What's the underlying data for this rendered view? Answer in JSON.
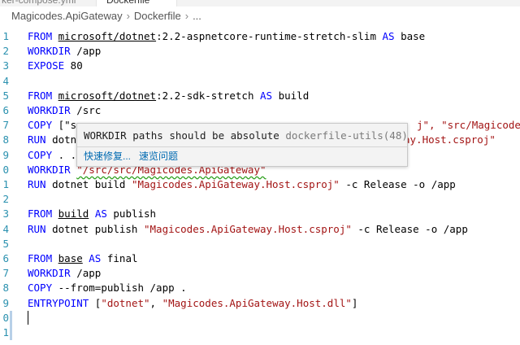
{
  "tabs": [
    {
      "label": "ker-compose.yml"
    },
    {
      "label": "Dockerfile"
    }
  ],
  "breadcrumbs": [
    "Magicodes.ApiGateway",
    "Dockerfile",
    "..."
  ],
  "editor": {
    "line_numbers": [
      "1",
      "2",
      "3",
      "4",
      "5",
      "6",
      "7",
      "8",
      "9",
      "0",
      "1",
      "2",
      "3",
      "4",
      "5",
      "6",
      "7",
      "8",
      "9",
      "0",
      "1"
    ],
    "lines": [
      {
        "kw": "FROM",
        "p1": " ",
        "ul": "microsoft/dotnet",
        "p2": ":2.2-aspnetcore-runtime-stretch-slim ",
        "kw2": "AS",
        "p3": " base"
      },
      {
        "kw": "WORKDIR",
        "p1": " /app"
      },
      {
        "kw": "EXPOSE",
        "p1": " 80"
      },
      {},
      {
        "kw": "FROM",
        "p1": " ",
        "ul": "microsoft/dotnet",
        "p2": ":2.2-sdk-stretch ",
        "kw2": "AS",
        "p3": " build"
      },
      {
        "kw": "WORKDIR",
        "p1": " /src"
      },
      {
        "kw": "COPY",
        "p1": " [\"s",
        "tail_str": "j\", \"src/Magicodes.Ap"
      },
      {
        "kw": "RUN",
        "p1": " dotn",
        "tail_str": "ay.Host.csproj\""
      },
      {
        "kw": "COPY",
        "p1": " . ."
      },
      {
        "kw": "WORKDIR",
        "p1": " ",
        "sq": "\"/src/src/Magicodes.ApiGateway\""
      },
      {
        "kw": "RUN",
        "p1": " dotnet build ",
        "str": "\"Magicodes.ApiGateway.Host.csproj\"",
        "p4": " -c Release -o /app"
      },
      {},
      {
        "kw": "FROM",
        "p1": " ",
        "ul": "build",
        "p2": " ",
        "kw2": "AS",
        "p3": " publish"
      },
      {
        "kw": "RUN",
        "p1": " dotnet publish ",
        "str": "\"Magicodes.ApiGateway.Host.csproj\"",
        "p4": " -c Release -o /app"
      },
      {},
      {
        "kw": "FROM",
        "p1": " ",
        "ul": "base",
        "p2": " ",
        "kw2": "AS",
        "p3": " final"
      },
      {
        "kw": "WORKDIR",
        "p1": " /app"
      },
      {
        "kw": "COPY",
        "p1": " --from=publish /app ."
      },
      {
        "kw": "ENTRYPOINT",
        "p1": " [",
        "str": "\"dotnet\"",
        "p4": ", ",
        "str2": "\"Magicodes.ApiGateway.Host.dll\"",
        "p5": "]"
      },
      {},
      {}
    ]
  },
  "hover": {
    "message": "WORKDIR paths should be absolute ",
    "source": "dockerfile-utils(48)",
    "actions": [
      "快速修复...",
      "速览问题"
    ]
  },
  "colors": {
    "keyword": "#0000ff",
    "string": "#a31515",
    "line_number": "#2b91af",
    "squiggle": "#2fa11f",
    "link": "#006ab1"
  }
}
